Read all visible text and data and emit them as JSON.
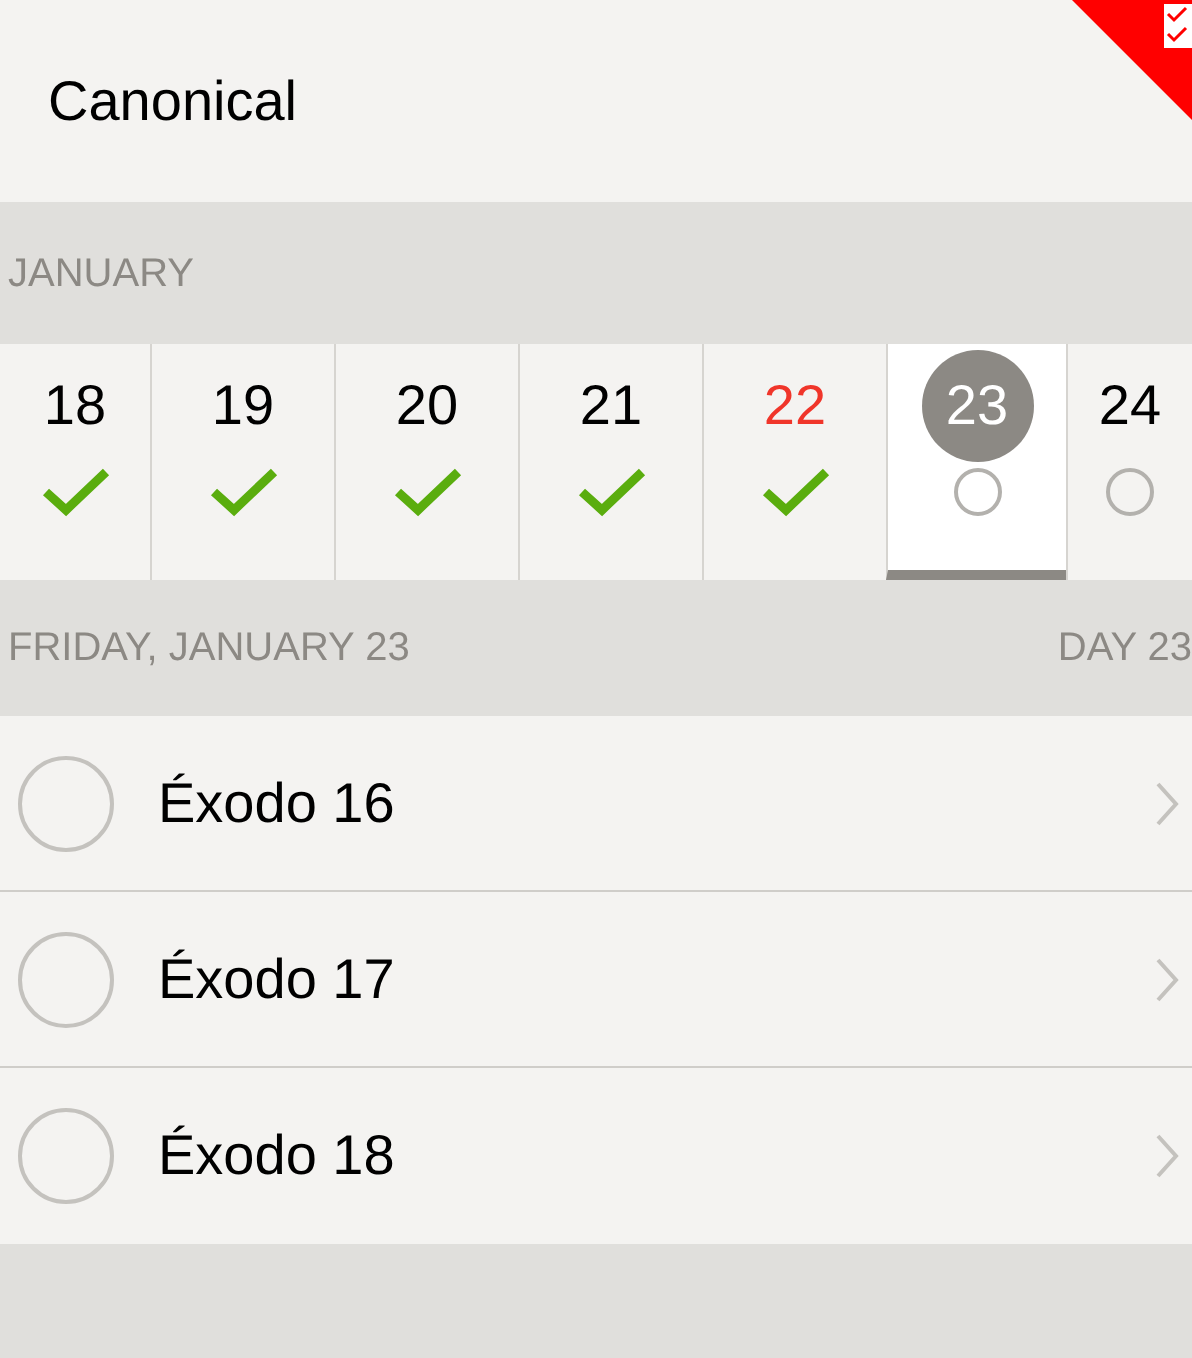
{
  "title": "Canonical",
  "month": "JANUARY",
  "days": [
    {
      "number": "18",
      "done": true,
      "today": false,
      "selected": false
    },
    {
      "number": "19",
      "done": true,
      "today": false,
      "selected": false
    },
    {
      "number": "20",
      "done": true,
      "today": false,
      "selected": false
    },
    {
      "number": "21",
      "done": true,
      "today": false,
      "selected": false
    },
    {
      "number": "22",
      "done": true,
      "today": true,
      "selected": false
    },
    {
      "number": "23",
      "done": false,
      "today": false,
      "selected": true
    },
    {
      "number": "24",
      "done": false,
      "today": false,
      "selected": false
    }
  ],
  "date_header": {
    "date": "FRIDAY, JANUARY 23",
    "day": "DAY 23"
  },
  "readings": [
    {
      "label": "Éxodo 16",
      "checked": false
    },
    {
      "label": "Éxodo 17",
      "checked": false
    },
    {
      "label": "Éxodo 18",
      "checked": false
    }
  ]
}
